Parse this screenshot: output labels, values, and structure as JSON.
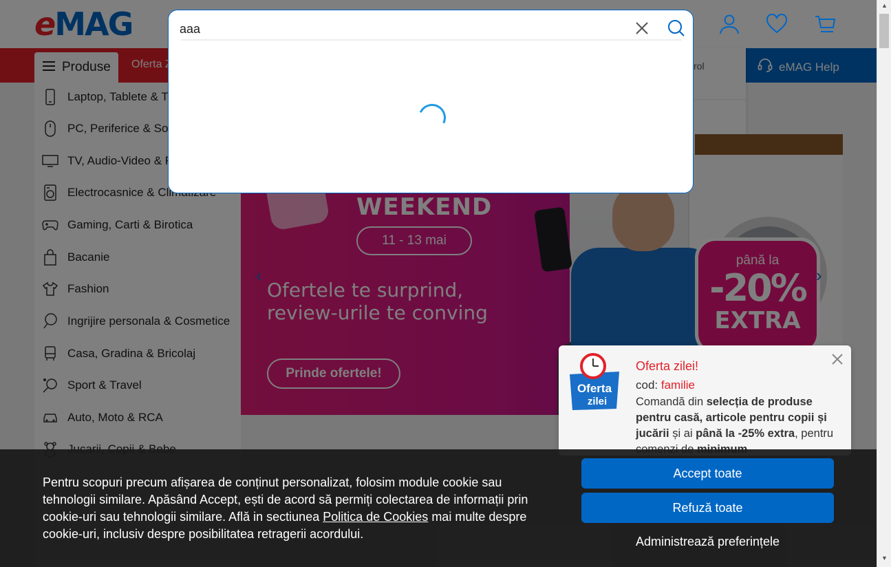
{
  "header": {
    "logo_e": "e",
    "logo_mag": "MAG",
    "account_icon": "user-icon",
    "favorites_icon": "heart-icon",
    "cart_icon": "cart-icon"
  },
  "nav": {
    "produse_label": "Produse",
    "oferta_label": "Oferta Z",
    "help_label": "eMAG Help",
    "help_icon": "headset-icon",
    "account_menu_fragment": "rol"
  },
  "sidebar": {
    "items": [
      {
        "label": "Laptop, Tablete & T",
        "icon": "phone-icon"
      },
      {
        "label": "PC, Periferice & Sof",
        "icon": "mouse-icon"
      },
      {
        "label": "TV, Audio-Video & F",
        "icon": "tv-icon"
      },
      {
        "label": "Electrocasnice & Climatizare",
        "icon": "washer-icon"
      },
      {
        "label": "Gaming, Carti & Birotica",
        "icon": "gamepad-icon"
      },
      {
        "label": "Bacanie",
        "icon": "bag-icon"
      },
      {
        "label": "Fashion",
        "icon": "tshirt-icon"
      },
      {
        "label": "Ingrijire personala & Cosmetice",
        "icon": "mirror-icon"
      },
      {
        "label": "Casa, Gradina & Bricolaj",
        "icon": "home-icon"
      },
      {
        "label": "Sport & Travel",
        "icon": "racket-icon"
      },
      {
        "label": "Auto, Moto & RCA",
        "icon": "car-icon"
      },
      {
        "label": "Jucarii, Copii & Bebe",
        "icon": "teddy-icon"
      }
    ]
  },
  "search": {
    "value": "aaa",
    "clear_icon": "close-icon",
    "search_icon": "search-icon",
    "loading": true
  },
  "banner": {
    "headline": "WEEKEND",
    "dates": "11 - 13 mai",
    "slogan_line1": "Ofertele te surprind,",
    "slogan_line2": "review-urile te conving",
    "cta": "Prinde ofertele!",
    "badge_line1": "până la",
    "badge_line2": "-20%",
    "badge_line3": "EXTRA"
  },
  "offer": {
    "logo_line1": "Oferta",
    "logo_line2": "zilei",
    "title": "Oferta zilei!",
    "code_label": "cod:",
    "code_value": "familie",
    "desc_1": "Comandă din ",
    "desc_2": "selecția de produse pentru casă, articole pentru copii și jucării",
    "desc_3": " și ai ",
    "desc_4": "până la -25% extra",
    "desc_5": ", pentru comenzi de ",
    "desc_6": "minimum"
  },
  "cookie": {
    "text_before": "Pentru scopuri precum afișarea de conținut personalizat, folosim module cookie sau tehnologii similare. Apăsând Accept, ești de acord să permiți colectarea de informații prin cookie-uri sau tehnologii similare. Află in sectiunea ",
    "link": "Politica de Cookies",
    "text_after": " mai multe despre cookie-uri, inclusiv despre posibilitatea retragerii acordului.",
    "accept": "Accept toate",
    "refuse": "Refuză toate",
    "manage": "Administrează preferințele"
  },
  "colors": {
    "brand_red": "#e22028",
    "brand_blue": "#0067c5",
    "spinner": "#1e9be3"
  }
}
